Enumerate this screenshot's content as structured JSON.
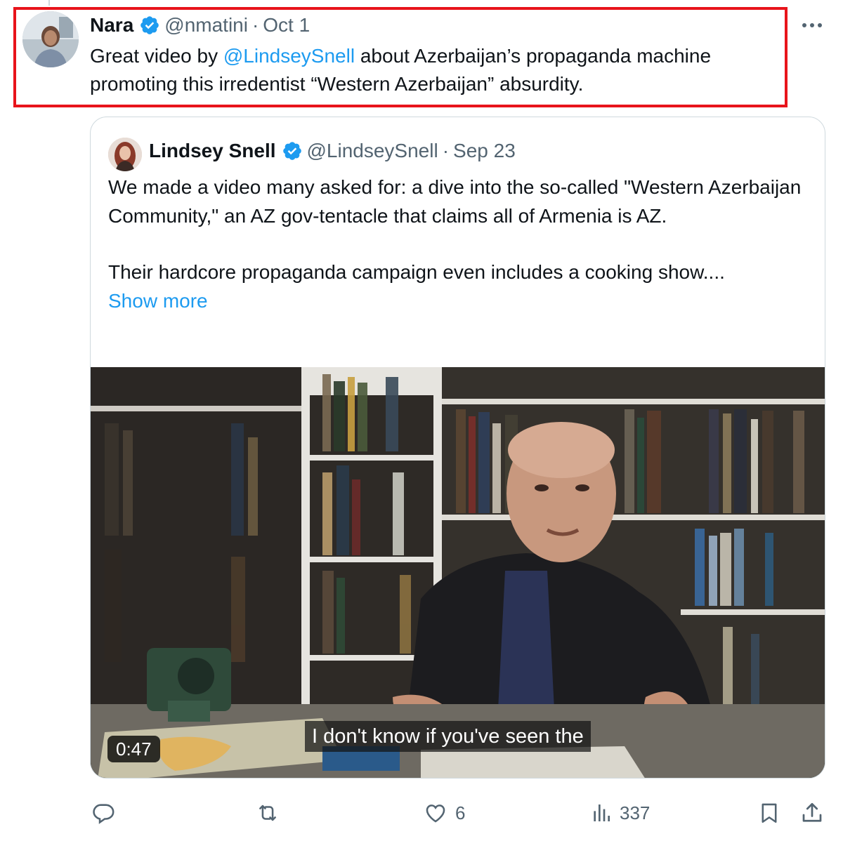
{
  "tweet": {
    "author_name": "Nara",
    "handle": "@nmatini",
    "separator": "·",
    "date": "Oct 1",
    "text_before": "Great video by ",
    "mention": "@LindseySnell",
    "text_after": " about Azerbaijan’s propaganda machine promoting this irredentist “Western Azerbaijan” absurdity."
  },
  "quote": {
    "author_name": "Lindsey Snell",
    "handle": "@LindseySnell",
    "separator": "·",
    "date": "Sep 23",
    "paragraph1": "We made a video many asked for: a dive into the so-called \"Western Azerbaijan Community,\" an AZ gov-tentacle that claims all of Armenia is AZ.",
    "paragraph2": "Their hardcore propaganda campaign even includes a cooking show....",
    "show_more": "Show more",
    "video": {
      "duration": "0:47",
      "subtitle": "I don't know if you've seen the"
    }
  },
  "actions": {
    "reply_count": "",
    "retweet_count": "",
    "like_count": "6",
    "views_count": "337"
  },
  "colors": {
    "accent": "#1d9bf0",
    "highlight": "#e8141b",
    "muted": "#536471"
  }
}
